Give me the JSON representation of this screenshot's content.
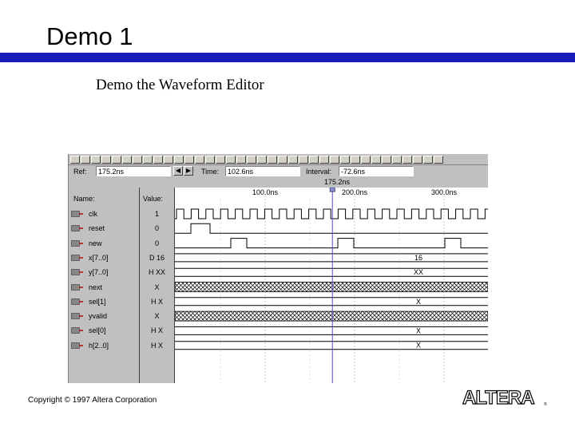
{
  "slide": {
    "title": "Demo 1",
    "subtitle": "Demo the Waveform Editor",
    "copyright": "Copyright © 1997 Altera Corporation",
    "logo_text": "ALTERA",
    "accent_color": "#1a1ab8"
  },
  "waveform_editor": {
    "ref_label": "Ref:",
    "ref_value": "175.2ns",
    "time_label": "Time:",
    "time_value": "102.6ns",
    "interval_label": "Interval:",
    "interval_value": "-72.6ns",
    "ref_marker_label": "175.2ns",
    "name_header": "Name:",
    "value_header": "Value:",
    "time_ticks": [
      "100.0ns",
      "200.0ns",
      "300.0ns"
    ],
    "signals": [
      {
        "name": "clk",
        "value": "1",
        "kind": "clock",
        "pin": "input"
      },
      {
        "name": "reset",
        "value": "0",
        "kind": "bit",
        "pin": "input"
      },
      {
        "name": "new",
        "value": "0",
        "kind": "bit",
        "pin": "input"
      },
      {
        "name": "x[7..0]",
        "value": "D 16",
        "kind": "bus",
        "bus_text": "16",
        "pin": "input"
      },
      {
        "name": "y[7..0]",
        "value": "H XX",
        "kind": "bus",
        "bus_text": "XX",
        "pin": "output"
      },
      {
        "name": "next",
        "value": "X",
        "kind": "unknown",
        "pin": "bidir"
      },
      {
        "name": "sel[1]",
        "value": "H X",
        "kind": "bus",
        "bus_text": "X",
        "pin": "node"
      },
      {
        "name": "yvalid",
        "value": "X",
        "kind": "unknown",
        "pin": "node"
      },
      {
        "name": "sel[0]",
        "value": "H X",
        "kind": "bus",
        "bus_text": "X",
        "pin": "node"
      },
      {
        "name": "h[2..0]",
        "value": "H X",
        "kind": "bus",
        "bus_text": "X",
        "pin": "node"
      }
    ]
  }
}
